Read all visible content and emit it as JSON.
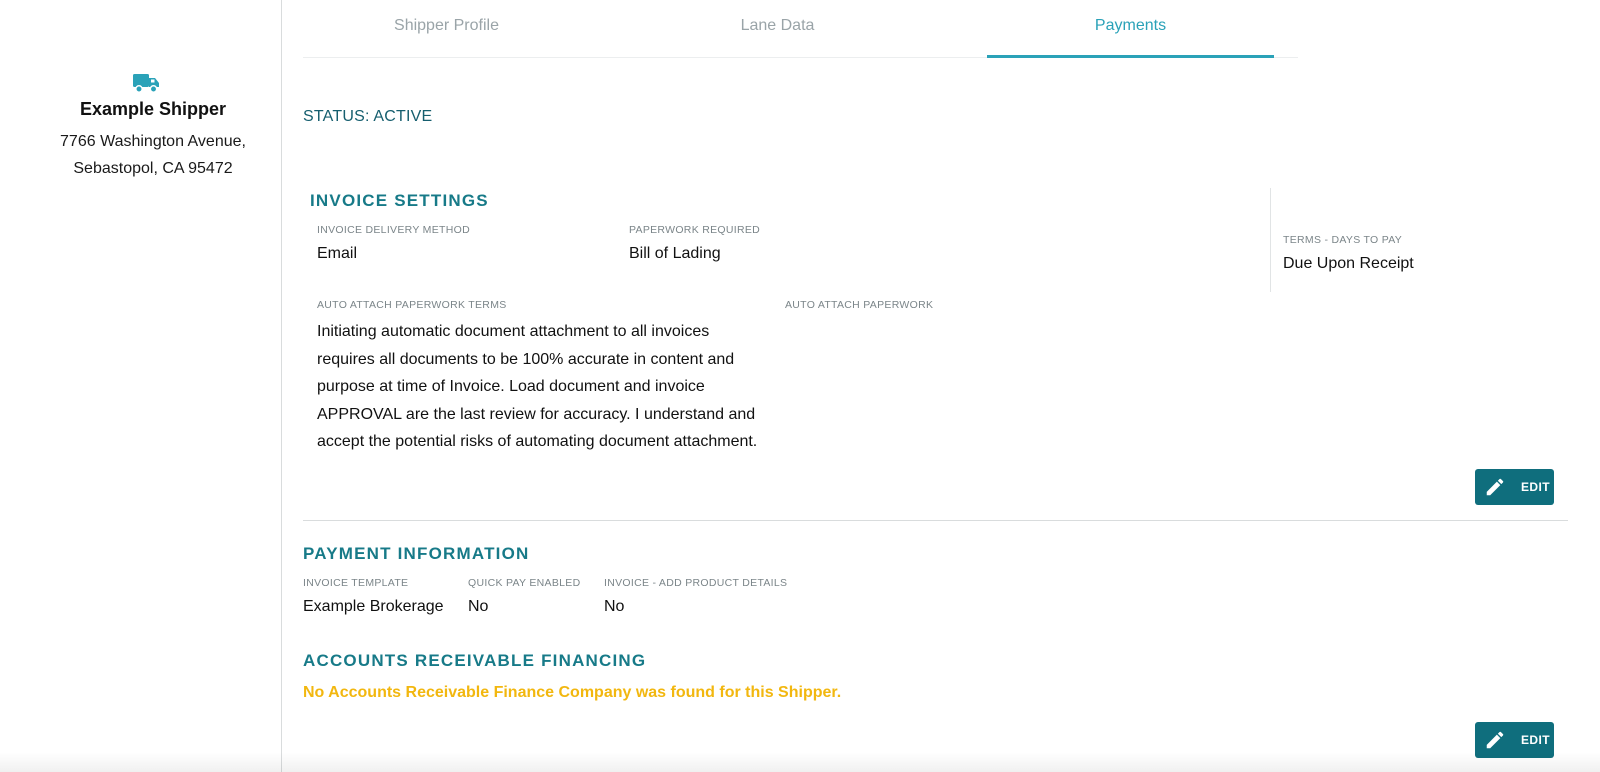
{
  "sidebar": {
    "icon": "truck-icon",
    "shipper_name": "Example Shipper",
    "address_line1": "7766 Washington Avenue,",
    "address_line2": "Sebastopol, CA 95472"
  },
  "tabs": [
    {
      "label": "Shipper Profile",
      "active": false
    },
    {
      "label": "Lane Data",
      "active": false
    },
    {
      "label": "Payments",
      "active": true
    }
  ],
  "status": "STATUS: ACTIVE",
  "invoice_settings": {
    "title": "INVOICE SETTINGS",
    "delivery_method_label": "INVOICE DELIVERY METHOD",
    "delivery_method_value": "Email",
    "paperwork_required_label": "PAPERWORK REQUIRED",
    "paperwork_required_value": "Bill of Lading",
    "terms_label": "TERMS - DAYS TO PAY",
    "terms_value": "Due Upon Receipt",
    "auto_attach_terms_label": "AUTO ATTACH PAPERWORK TERMS",
    "auto_attach_terms_text": "Initiating automatic document attachment to all invoices requires all documents to be 100% accurate in content and purpose at time of Invoice. Load document and invoice APPROVAL are the last review for accuracy. I understand and accept the potential risks of automating document attachment.",
    "auto_attach_label": "AUTO ATTACH PAPERWORK",
    "edit_label": "EDIT"
  },
  "payment_information": {
    "title": "PAYMENT INFORMATION",
    "invoice_template_label": "INVOICE TEMPLATE",
    "invoice_template_value": "Example Brokerage",
    "quick_pay_label": "QUICK PAY ENABLED",
    "quick_pay_value": "No",
    "add_product_details_label": "INVOICE - ADD PRODUCT DETAILS",
    "add_product_details_value": "No"
  },
  "ar_financing": {
    "title": "ACCOUNTS RECEIVABLE FINANCING",
    "warning": "No Accounts Receivable Finance Company was found for this Shipper.",
    "edit_label": "EDIT"
  },
  "colors": {
    "accent": "#2aa2b8",
    "section_title": "#177a88",
    "button": "#0f6e7d",
    "warning": "#f2b70f"
  }
}
